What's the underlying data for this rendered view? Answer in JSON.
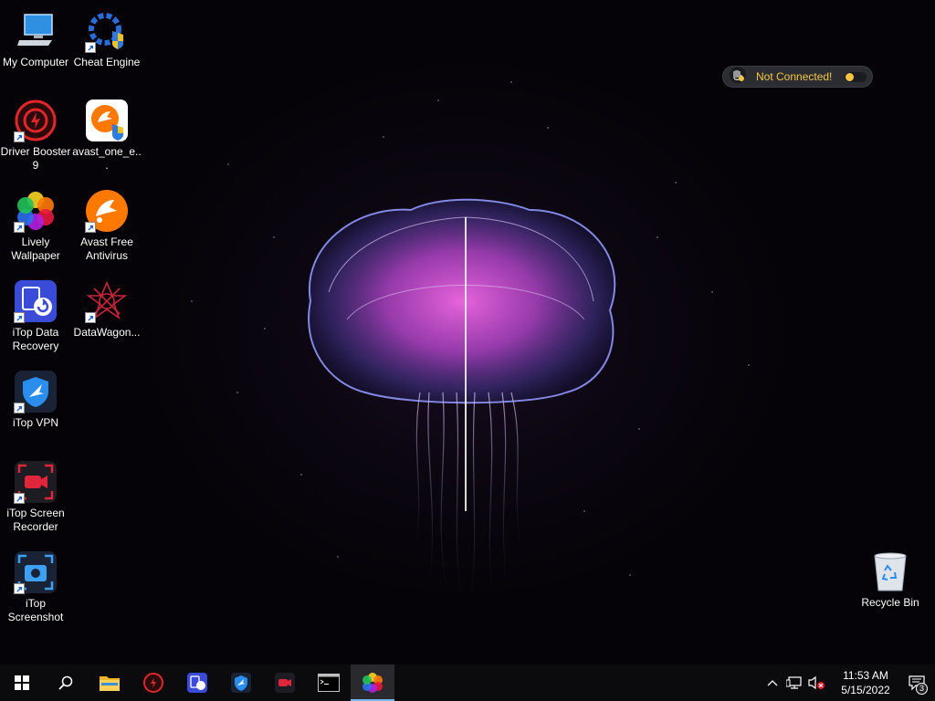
{
  "desktop": {
    "icons": [
      {
        "label": "My Computer",
        "icon": "computer-icon"
      },
      {
        "label": "Cheat Engine",
        "icon": "cheat-engine-icon"
      },
      {
        "label": "Driver Booster 9",
        "icon": "driver-booster-icon"
      },
      {
        "label": "avast_one_e...",
        "icon": "avast-one-icon"
      },
      {
        "label": "Lively Wallpaper",
        "icon": "lively-wallpaper-icon"
      },
      {
        "label": "Avast Free Antivirus",
        "icon": "avast-antivirus-icon"
      },
      {
        "label": "iTop Data Recovery",
        "icon": "itop-data-recovery-icon"
      },
      {
        "label": "DataWagon...",
        "icon": "datawagon-icon"
      },
      {
        "label": "iTop VPN",
        "icon": "itop-vpn-icon"
      },
      {
        "label": "iTop Screen Recorder",
        "icon": "itop-screen-recorder-icon"
      },
      {
        "label": "iTop Screenshot",
        "icon": "itop-screenshot-icon"
      },
      {
        "label": "Recycle Bin",
        "icon": "recycle-bin-icon"
      }
    ]
  },
  "vpn_widget": {
    "status": "Not Connected!",
    "status_color": "#f5c542"
  },
  "taskbar": {
    "apps": [
      "start",
      "search",
      "file-explorer",
      "driver-booster",
      "itop-data-recovery",
      "itop-vpn",
      "itop-screen-recorder",
      "command-prompt",
      "lively-wallpaper"
    ],
    "active_app": "lively-wallpaper",
    "clock": {
      "time": "11:53 AM",
      "date": "5/15/2022"
    },
    "notification_count": "3"
  }
}
